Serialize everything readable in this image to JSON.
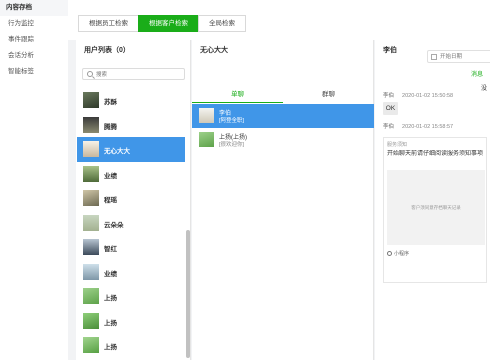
{
  "sidebar": {
    "title": "内容存档",
    "items": [
      "行为监控",
      "事件跟踪",
      "会话分析",
      "智能标签"
    ]
  },
  "tabs": [
    "根据员工检索",
    "根据客户检索",
    "全局检索"
  ],
  "active_tab": 1,
  "users_panel": {
    "title": "用户列表（0）",
    "search_placeholder": "搜索",
    "users": [
      "苏酥",
      "腾腾",
      "无心大大",
      "业绩",
      "程瑶",
      "云朵朵",
      "智红",
      "业绩",
      "上扬",
      "上扬",
      "上扬"
    ],
    "selected_index": 2
  },
  "conv_panel": {
    "title": "无心大大",
    "tabs": [
      "单聊",
      "群聊"
    ],
    "active_tab": 0,
    "conversations": [
      {
        "name": "李伯",
        "sub": "[阿登全职]"
      },
      {
        "name": "上扬(上扬)",
        "sub": "[很欢迎你]"
      }
    ],
    "selected_index": 0
  },
  "detail": {
    "title": "李伯",
    "date_placeholder": "开始日期",
    "message_link": "消息",
    "edge_text": "没",
    "messages": [
      {
        "sender": "李伯",
        "time": "2020-01-02 15:50:58"
      },
      {
        "sender": "李伯",
        "time": "2020-01-02 15:58:57"
      }
    ],
    "bubble_text": "OK",
    "card": {
      "source": "服务须知",
      "title": "开始聊天前请仔细阅读服务须知事项",
      "image_caption": "客户须同意存档聊天记录",
      "footer": "小程序"
    }
  },
  "colors": {
    "accent_green": "#1aad19",
    "selected_blue": "#4096e8"
  }
}
